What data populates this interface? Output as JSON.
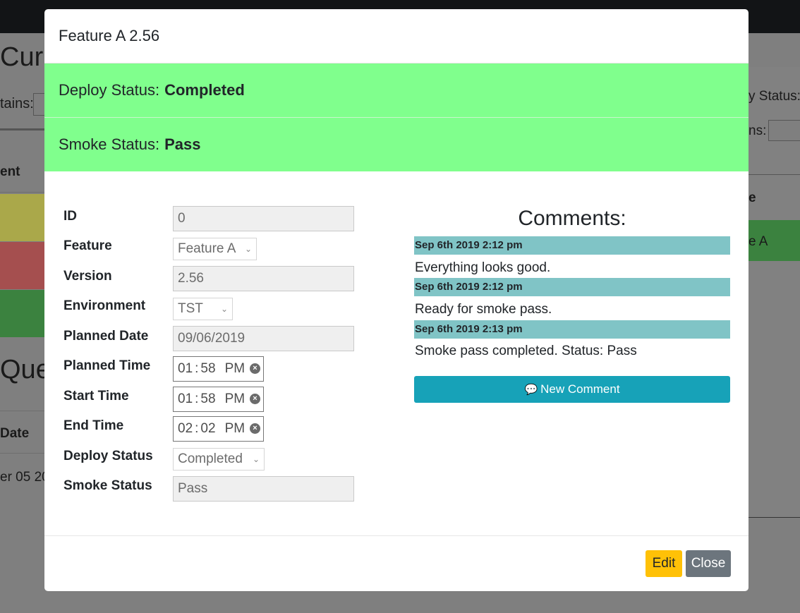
{
  "background": {
    "title_curr": "Curr",
    "contains_label": "tains:",
    "table_header_left": "ent",
    "queue_title": "Queu",
    "date_header": "Date",
    "date_value": "er 05 20",
    "right_status_label": "y Status:",
    "right_ins_label": "ns:",
    "right_header": "e",
    "right_cell": "e A",
    "row_colors": [
      "#aaa84a",
      "#a54f4f",
      "#3b823f"
    ]
  },
  "modal": {
    "title": "Feature A 2.56",
    "deploy_status_label": "Deploy Status:",
    "deploy_status_value": "Completed",
    "deploy_status_color": "#80ff8d",
    "smoke_status_label": "Smoke Status:",
    "smoke_status_value": "Pass",
    "form": {
      "id_label": "ID",
      "id_value": "0",
      "feature_label": "Feature",
      "feature_value": "Feature A",
      "version_label": "Version",
      "version_value": "2.56",
      "environment_label": "Environment",
      "environment_value": "TST",
      "planned_date_label": "Planned Date",
      "planned_date_value": "09/06/2019",
      "planned_time_label": "Planned Time",
      "planned_time": {
        "hh": "01",
        "mm": "58",
        "ampm": "PM"
      },
      "start_time_label": "Start Time",
      "start_time": {
        "hh": "01",
        "mm": "58",
        "ampm": "PM"
      },
      "end_time_label": "End Time",
      "end_time": {
        "hh": "02",
        "mm": "02",
        "ampm": "PM"
      },
      "deploy_status_label": "Deploy Status",
      "deploy_status_value": "Completed",
      "smoke_status_label": "Smoke Status",
      "smoke_status_value": "Pass"
    },
    "comments": {
      "title": "Comments:",
      "items": [
        {
          "timestamp": "Sep 6th 2019 2:12 pm",
          "text": "Everything looks good."
        },
        {
          "timestamp": "Sep 6th 2019 2:12 pm",
          "text": "Ready for smoke pass."
        },
        {
          "timestamp": "Sep 6th 2019 2:13 pm",
          "text": "Smoke pass completed. Status: Pass"
        }
      ],
      "new_comment_label": "New Comment",
      "new_comment_icon": "comment-icon"
    },
    "footer": {
      "edit_label": "Edit",
      "close_label": "Close"
    }
  }
}
